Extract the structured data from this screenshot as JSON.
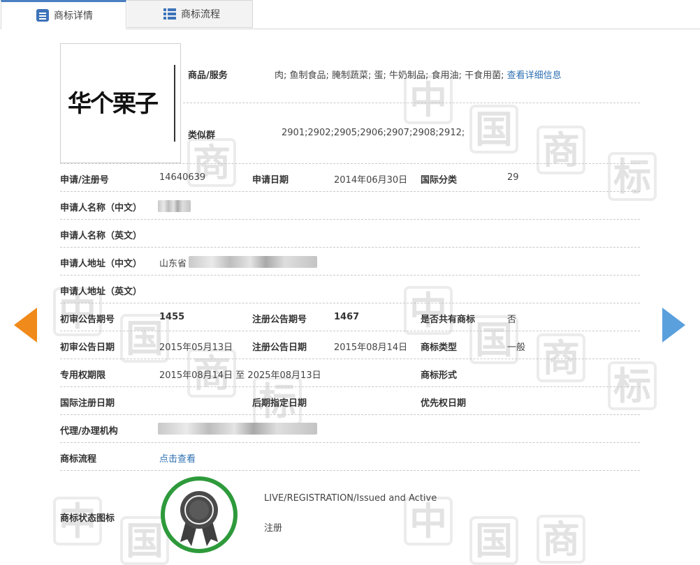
{
  "tabs": [
    {
      "label": "商标详情",
      "icon": "document-icon",
      "active": true
    },
    {
      "label": "商标流程",
      "icon": "list-icon",
      "active": false
    }
  ],
  "logo": {
    "text": "华个栗子"
  },
  "goods": {
    "label": "商品/服务",
    "value": "肉; 鱼制食品; 腌制蔬菜; 蛋; 牛奶制品; 食用油; 干食用菌;",
    "link": "查看详细信息"
  },
  "similar": {
    "label": "类似群",
    "value": "2901;2902;2905;2906;2907;2908;2912;"
  },
  "reg_no": {
    "label": "申请/注册号",
    "value": "14640639"
  },
  "app_date": {
    "label": "申请日期",
    "value": "2014年06月30日"
  },
  "intl_class": {
    "label": "国际分类",
    "value": "29"
  },
  "applicant_cn": {
    "label": "申请人名称（中文）"
  },
  "applicant_en": {
    "label": "申请人名称（英文）"
  },
  "address_cn": {
    "label": "申请人地址（中文）",
    "value": "山东省"
  },
  "address_en": {
    "label": "申请人地址（英文）"
  },
  "prelim_no": {
    "label": "初审公告期号",
    "value": "1455"
  },
  "reg_pub_no": {
    "label": "注册公告期号",
    "value": "1467"
  },
  "shared": {
    "label": "是否共有商标",
    "value": "否"
  },
  "prelim_date": {
    "label": "初审公告日期",
    "value": "2015年05月13日"
  },
  "reg_pub_date": {
    "label": "注册公告日期",
    "value": "2015年08月14日"
  },
  "tm_type": {
    "label": "商标类型",
    "value": "一般"
  },
  "exclusive": {
    "label": "专用权期限",
    "value": "2015年08月14日 至 2025年08月13日"
  },
  "tm_form": {
    "label": "商标形式"
  },
  "intl_reg_date": {
    "label": "国际注册日期"
  },
  "later_date": {
    "label": "后期指定日期"
  },
  "priority_date": {
    "label": "优先权日期"
  },
  "agent": {
    "label": "代理/办理机构"
  },
  "flow": {
    "label": "商标流程",
    "link": "点击查看"
  },
  "status": {
    "label": "商标状态图标",
    "en": "LIVE/REGISTRATION/Issued and Active",
    "cn": "注册"
  },
  "watermark": [
    "中",
    "国",
    "商",
    "标"
  ],
  "colors": {
    "accent": "#2d6fb2",
    "arrow_left": "#f08a1a",
    "arrow_right": "#5aa0dd",
    "badge_ring": "#2e9a3b"
  }
}
